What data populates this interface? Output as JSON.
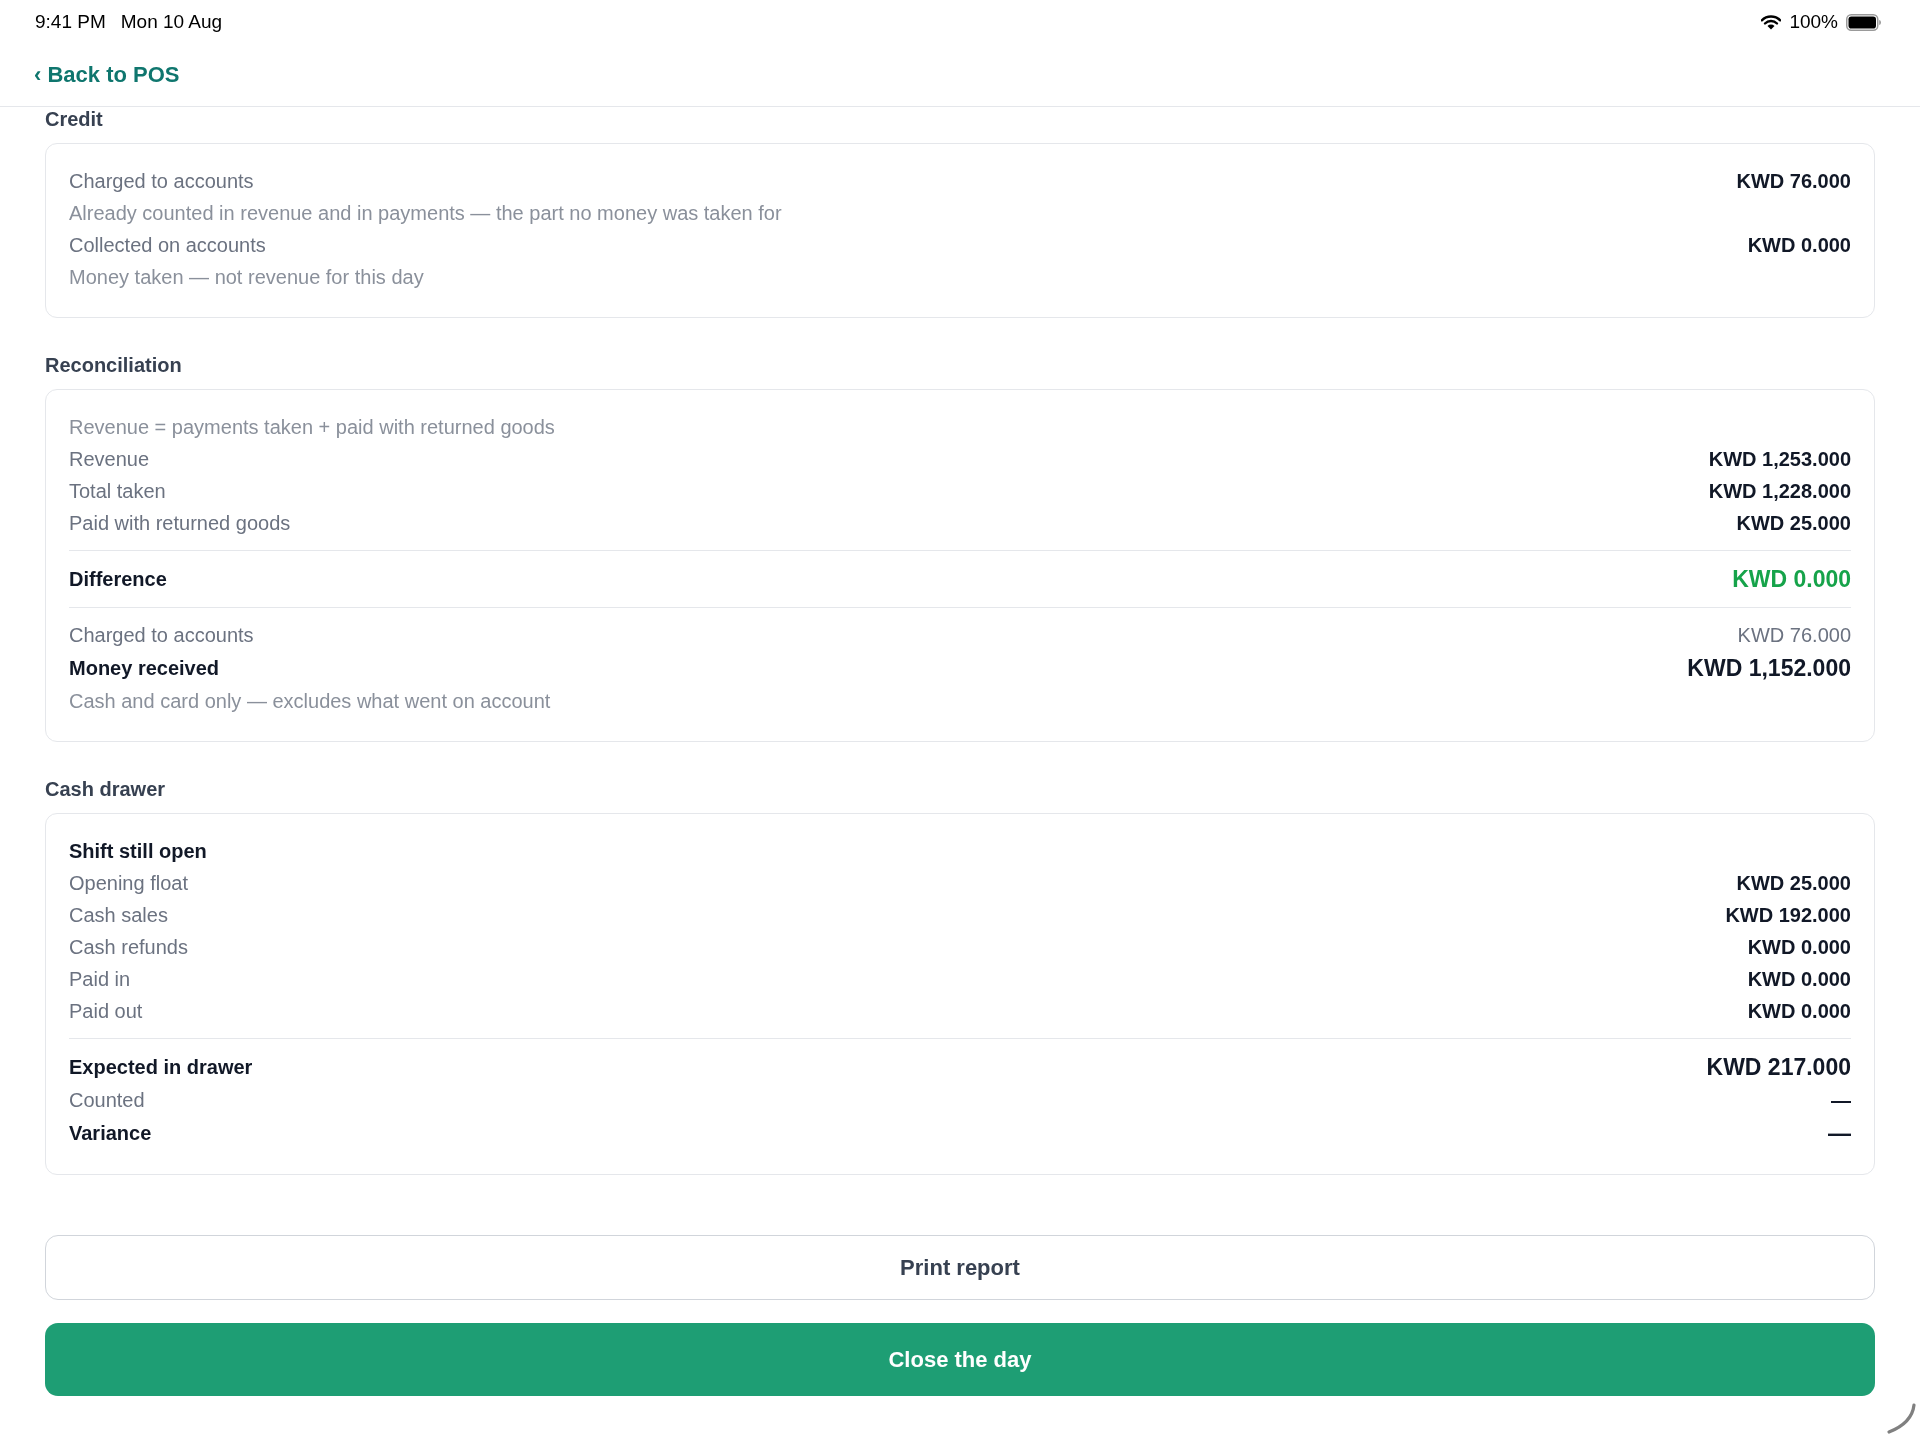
{
  "status_bar": {
    "time": "9:41 PM",
    "date": "Mon 10 Aug",
    "battery_text": "100%"
  },
  "nav": {
    "back_link": "‹ Back to POS"
  },
  "sections": [
    {
      "title": "Credit",
      "groups": [
        {
          "rows": [
            {
              "kind": "item",
              "label": "Charged to accounts",
              "value": "KWD 76.000"
            },
            {
              "kind": "note",
              "text": "Already counted in revenue and in payments — the part no money was taken for"
            },
            {
              "kind": "item",
              "label": "Collected on accounts",
              "value": "KWD 0.000"
            },
            {
              "kind": "note",
              "text": "Money taken — not revenue for this day"
            }
          ]
        }
      ]
    },
    {
      "title": "Reconciliation",
      "groups": [
        {
          "rows": [
            {
              "kind": "note",
              "text": "Revenue = payments taken + paid with returned goods"
            },
            {
              "kind": "item",
              "label": "Revenue",
              "value": "KWD 1,253.000"
            },
            {
              "kind": "item",
              "label": "Total taken",
              "value": "KWD 1,228.000"
            },
            {
              "kind": "item",
              "label": "Paid with returned goods",
              "value": "KWD 25.000"
            }
          ]
        },
        {
          "rows": [
            {
              "kind": "total-good",
              "label": "Difference",
              "value": "KWD 0.000"
            }
          ]
        },
        {
          "rows": [
            {
              "kind": "item-faint",
              "label": "Charged to accounts",
              "value": "KWD 76.000"
            },
            {
              "kind": "total",
              "label": "Money received",
              "value": "KWD 1,152.000"
            },
            {
              "kind": "note",
              "text": "Cash and card only — excludes what went on account"
            }
          ]
        }
      ]
    },
    {
      "title": "Cash drawer",
      "groups": [
        {
          "rows": [
            {
              "kind": "heading",
              "label": "Shift still open"
            },
            {
              "kind": "item",
              "label": "Opening float",
              "value": "KWD 25.000"
            },
            {
              "kind": "item",
              "label": "Cash sales",
              "value": "KWD 192.000"
            },
            {
              "kind": "item",
              "label": "Cash refunds",
              "value": "KWD 0.000"
            },
            {
              "kind": "item",
              "label": "Paid in",
              "value": "KWD 0.000"
            },
            {
              "kind": "item",
              "label": "Paid out",
              "value": "KWD 0.000"
            }
          ]
        },
        {
          "rows": [
            {
              "kind": "total",
              "label": "Expected in drawer",
              "value": "KWD 217.000"
            },
            {
              "kind": "item",
              "label": "Counted",
              "value": "—"
            },
            {
              "kind": "total",
              "label": "Variance",
              "value": "—"
            }
          ]
        }
      ]
    }
  ],
  "buttons": [
    {
      "kind": "secondary",
      "label": "Print report"
    },
    {
      "kind": "primary",
      "label": "Close the day"
    }
  ]
}
